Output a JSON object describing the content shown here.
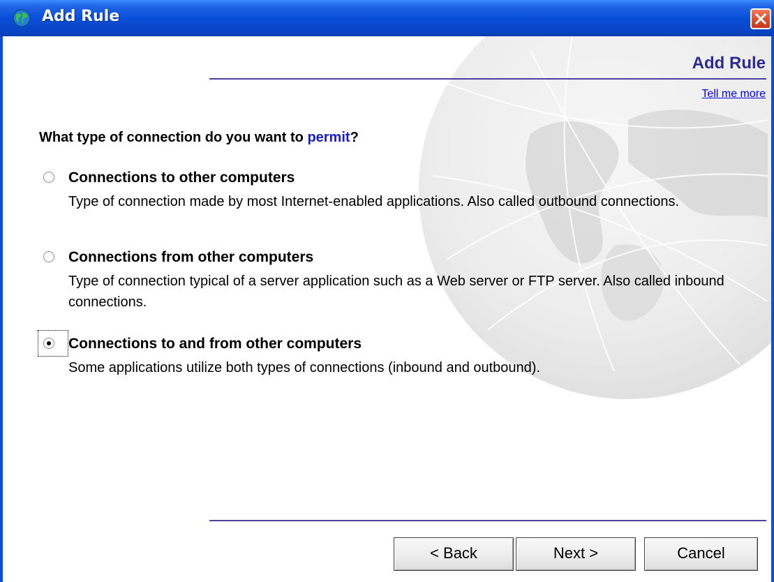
{
  "window": {
    "title": "Add Rule"
  },
  "header": {
    "title": "Add Rule",
    "help_link": "Tell me more"
  },
  "question": {
    "prefix": "What type of connection do you want to ",
    "keyword": "permit",
    "suffix": "?"
  },
  "options": [
    {
      "label": "Connections to other computers",
      "description": "Type of connection made by most Internet-enabled applications. Also called outbound connections.",
      "selected": false
    },
    {
      "label": "Connections from other computers",
      "description": "Type of connection typical of a server application such as a Web server or FTP server. Also called inbound connections.",
      "selected": false
    },
    {
      "label": "Connections to and from other computers",
      "description": "Some applications utilize both types of connections (inbound and outbound).",
      "selected": true
    }
  ],
  "buttons": {
    "back": "< Back",
    "next": "Next >",
    "cancel": "Cancel"
  },
  "colors": {
    "titlebar": "#0a4fd8",
    "accent_line": "#4b3fa0",
    "header_title": "#2d2b8f",
    "link": "#0000ee",
    "keyword": "#1a1acf",
    "close_button": "#e0502c"
  },
  "icons": {
    "title": "globe-icon",
    "close": "close-icon"
  }
}
